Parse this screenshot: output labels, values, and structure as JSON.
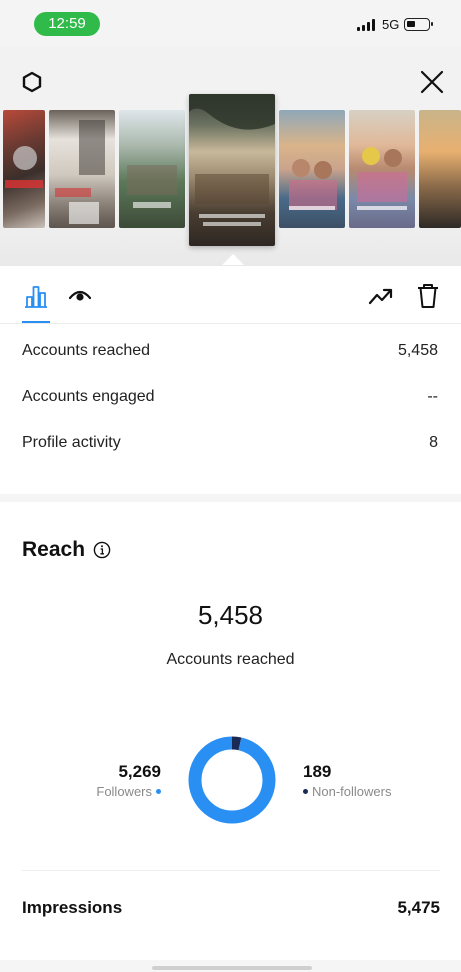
{
  "status_bar": {
    "time": "12:59",
    "network": "5G"
  },
  "colors": {
    "accent": "#2a8ff3",
    "followers": "#2a8ff3",
    "non_followers": "#1a2a55",
    "status_green": "#2fba4a"
  },
  "stats": {
    "rows": [
      {
        "label": "Accounts reached",
        "value": "5,458"
      },
      {
        "label": "Accounts engaged",
        "value": "--"
      },
      {
        "label": "Profile activity",
        "value": "8"
      }
    ]
  },
  "reach": {
    "title": "Reach",
    "total": "5,458",
    "caption": "Accounts reached",
    "followers": {
      "value": "5,269",
      "label": "Followers",
      "count": 5269
    },
    "non_followers": {
      "value": "189",
      "label": "Non-followers",
      "count": 189
    }
  },
  "impressions": {
    "label": "Impressions",
    "value": "5,475"
  },
  "icons": [
    "gear-icon",
    "close-icon",
    "bar-chart-icon",
    "eye-icon",
    "trending-up-icon",
    "trash-icon",
    "info-icon"
  ]
}
